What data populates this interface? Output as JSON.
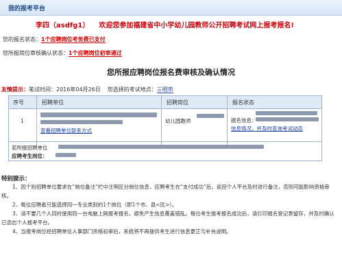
{
  "header": {
    "title": "我的报考平台"
  },
  "welcome": {
    "name": "李四（asdfg1）",
    "message": "欢迎您参加福建省中小学幼儿园教师公开招聘考试网上报考报名!"
  },
  "status": {
    "signup_label": "您的报名状态：",
    "signup_value": "1个应聘岗位考务费已支付",
    "review_label": "您所报岗位审核确认状态：",
    "review_value": "1个应聘岗位初审通过"
  },
  "section": {
    "title": "您所报应聘岗位报名费审核及确认情况"
  },
  "tips": {
    "label": "友情提示：",
    "exam_time": "笔试时间：2016年04月26日",
    "area_label": "您选择的考试地点：",
    "area_value": "三明市"
  },
  "table": {
    "headers": [
      "序号",
      "招聘单位",
      "招聘岗位",
      "报名状态"
    ],
    "rows": [
      {
        "index": "1",
        "unit_link": "查看招聘单位联系方式",
        "post": "幼儿园教师",
        "status_partial": "报名信息：",
        "status_tail": "信息情况，并及时查询考试动态"
      }
    ],
    "footer_1": "若所报招聘单位",
    "footer_2": "应聘考生岗位："
  },
  "notice": {
    "title": "特别提示：",
    "items": [
      "1、因个别招聘单位要求在“岗位备注”栏中注明区分岗位信息，应聘考生在“支付成功”后，返回个人平台及时进行备注，否则可能影响资格审核。",
      "2、每位应聘者只能选择同一专业类别的1个岗位（即1个市、县<区>）。",
      "3、请不要几个人同时使用同一台电脑上网报考报名，避免产生信息覆盖错乱。每位考生报考报名成功后，请打印报名登记表留存，并及时确认已选出个人报考平台。",
      "4、当报考岗位经招聘单位人事部门资格初审后，系统将不再提供考生进行信息更正与补充说明。"
    ]
  }
}
